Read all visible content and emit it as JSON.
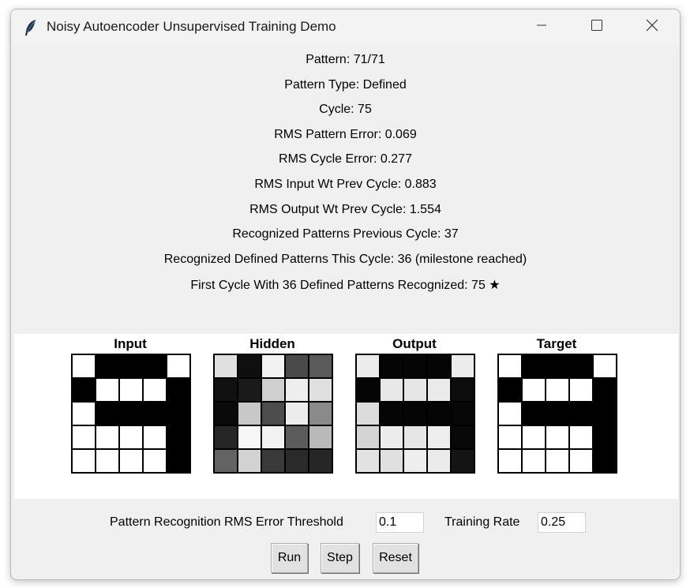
{
  "window": {
    "title": "Noisy Autoencoder Unsupervised Training Demo"
  },
  "stats": [
    "Pattern: 71/71",
    "Pattern Type: Defined",
    "Cycle: 75",
    "RMS Pattern Error: 0.069",
    "RMS Cycle Error: 0.277",
    "RMS Input Wt Prev Cycle: 0.883",
    "RMS Output Wt Prev Cycle: 1.554",
    "Recognized Patterns Previous Cycle: 37",
    "Recognized Defined Patterns This Cycle: 36 (milestone reached)",
    "First Cycle With 36 Defined Patterns Recognized: 75 ★"
  ],
  "grids": [
    {
      "title": "Input",
      "cells": [
        "#ffffff",
        "#000000",
        "#000000",
        "#000000",
        "#ffffff",
        "#000000",
        "#ffffff",
        "#ffffff",
        "#ffffff",
        "#000000",
        "#ffffff",
        "#000000",
        "#000000",
        "#000000",
        "#000000",
        "#ffffff",
        "#ffffff",
        "#ffffff",
        "#ffffff",
        "#000000",
        "#ffffff",
        "#ffffff",
        "#ffffff",
        "#ffffff",
        "#000000"
      ]
    },
    {
      "title": "Hidden",
      "cells": [
        "#e0e0e0",
        "#0f0f0f",
        "#f2f2f2",
        "#4a4a4a",
        "#5a5a5a",
        "#111111",
        "#1a1a1a",
        "#cfcfcf",
        "#eeeeee",
        "#e0e0e0",
        "#0a0a0a",
        "#c8c8c8",
        "#4d4d4d",
        "#ececec",
        "#8a8a8a",
        "#262626",
        "#f7f7f7",
        "#f2f2f2",
        "#5c5c5c",
        "#b9b9b9",
        "#646464",
        "#d2d2d2",
        "#3a3a3a",
        "#2a2a2a",
        "#262626"
      ]
    },
    {
      "title": "Output",
      "cells": [
        "#ececec",
        "#050505",
        "#050505",
        "#050505",
        "#ececec",
        "#050505",
        "#e8e8e8",
        "#e6e6e6",
        "#eaeaea",
        "#0c0c0c",
        "#dcdcdc",
        "#050505",
        "#050505",
        "#050505",
        "#070707",
        "#d4d4d4",
        "#ececec",
        "#e6e6e6",
        "#eeeeee",
        "#080808",
        "#e2e2e2",
        "#e0e0e0",
        "#eeeeee",
        "#ebebeb",
        "#141414"
      ]
    },
    {
      "title": "Target",
      "cells": [
        "#ffffff",
        "#000000",
        "#000000",
        "#000000",
        "#ffffff",
        "#000000",
        "#ffffff",
        "#ffffff",
        "#ffffff",
        "#000000",
        "#ffffff",
        "#000000",
        "#000000",
        "#000000",
        "#000000",
        "#ffffff",
        "#ffffff",
        "#ffffff",
        "#ffffff",
        "#000000",
        "#ffffff",
        "#ffffff",
        "#ffffff",
        "#ffffff",
        "#000000"
      ]
    }
  ],
  "controls": {
    "threshold_label": "Pattern Recognition RMS Error Threshold",
    "threshold_value": "0.1",
    "rate_label": "Training Rate",
    "rate_value": "0.25"
  },
  "buttons": {
    "run": "Run",
    "step": "Step",
    "reset": "Reset"
  }
}
